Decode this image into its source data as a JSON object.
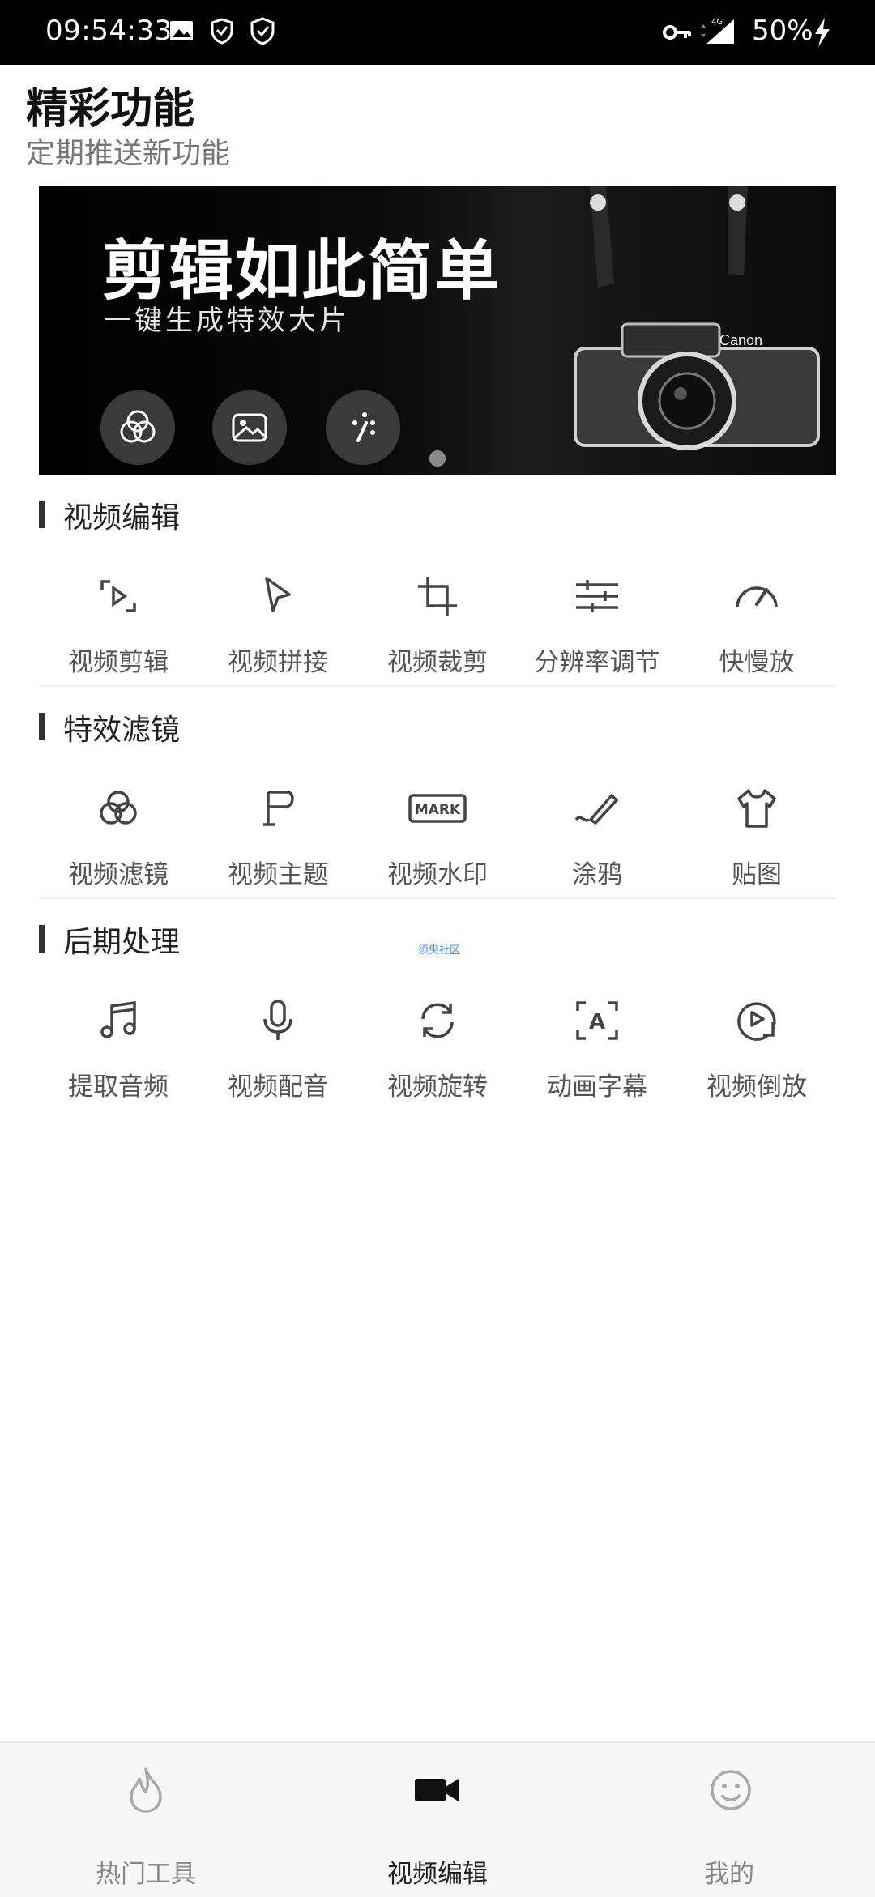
{
  "status_bar": {
    "time": "09:54:33",
    "battery": "50%",
    "network": "4G"
  },
  "header": {
    "title": "精彩功能",
    "subtitle": "定期推送新功能"
  },
  "banner": {
    "title": "剪辑如此简单",
    "subtitle": "一键生成特效大片",
    "camera_brand": "Canon"
  },
  "sections": [
    {
      "label": "视频编辑",
      "items": [
        "视频剪辑",
        "视频拼接",
        "视频裁剪",
        "分辨率调节",
        "快慢放"
      ]
    },
    {
      "label": "特效滤镜",
      "items": [
        "视频滤镜",
        "视频主题",
        "视频水印",
        "涂鸦",
        "贴图"
      ]
    },
    {
      "label": "后期处理",
      "items": [
        "提取音频",
        "视频配音",
        "视频旋转",
        "动画字幕",
        "视频倒放"
      ]
    }
  ],
  "watermark_text": "须臾社区",
  "mark_icon_text": "MARK",
  "caption_icon_text": "A",
  "bottom_nav": {
    "items": [
      "热门工具",
      "视频编辑",
      "我的"
    ],
    "active": "视频编辑"
  },
  "colors": {
    "icon": "#444444",
    "nav_active": "#222222",
    "nav_inactive": "#888888"
  }
}
